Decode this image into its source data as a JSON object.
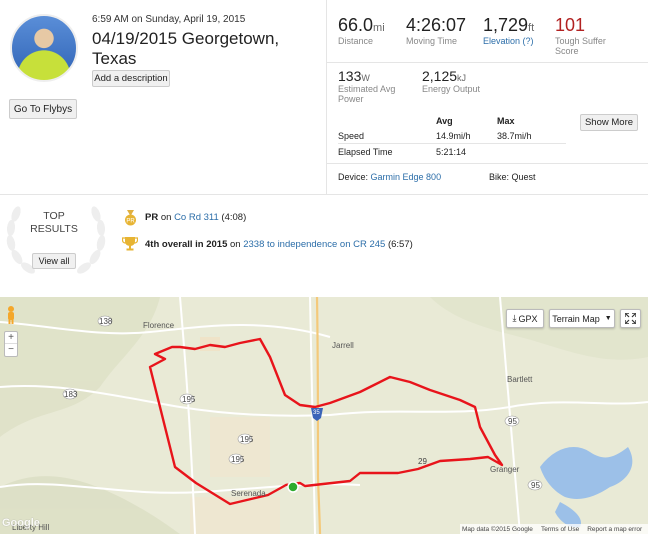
{
  "header": {
    "datetime": "6:59 AM on Sunday, April 19, 2015",
    "title": "04/19/2015 Georgetown, Texas",
    "add_description": "Add a description",
    "go_to_flybys": "Go To Flybys"
  },
  "stats": {
    "distance": {
      "value": "66.0",
      "unit": "mi",
      "label": "Distance"
    },
    "moving_time": {
      "value": "4:26:07",
      "label": "Moving Time"
    },
    "elevation": {
      "value": "1,729",
      "unit": "ft",
      "label": "Elevation (?)"
    },
    "suffer": {
      "value": "101",
      "label": "Tough Suffer Score",
      "color": "#b22222"
    },
    "power": {
      "value": "133",
      "unit": "W",
      "label": "Estimated Avg Power"
    },
    "energy": {
      "value": "2,125",
      "unit": "kJ",
      "label": "Energy Output"
    },
    "table": {
      "avg_header": "Avg",
      "max_header": "Max",
      "speed_label": "Speed",
      "speed_avg": "14.9mi/h",
      "speed_max": "38.7mi/h",
      "elapsed_label": "Elapsed Time",
      "elapsed_avg": "5:21:14"
    },
    "show_more": "Show More",
    "device_label": "Device:",
    "device_value": "Garmin Edge 800",
    "bike_label": "Bike:",
    "bike_value": "Quest"
  },
  "top_results": {
    "title_line1": "TOP",
    "title_line2": "RESULTS",
    "view_all": "View all",
    "items": [
      {
        "bold": "PR",
        "mid": " on ",
        "link": "Co Rd 311",
        "tail": " (4:08)"
      },
      {
        "bold": "4th overall in 2015",
        "mid": " on ",
        "link": "2338 to independence on CR 245",
        "tail": " (6:57)"
      }
    ]
  },
  "map": {
    "gpx": "GPX",
    "map_type": "Terrain Map",
    "zoom_in": "+",
    "zoom_out": "−",
    "towns": {
      "florence": "Florence",
      "jarrell": "Jarrell",
      "bartlett": "Bartlett",
      "granger": "Granger",
      "serenada": "Serenada",
      "liberty_hill": "Liberty Hill"
    },
    "roads": {
      "r138": "138",
      "r183": "183",
      "r195a": "195",
      "r195b": "195",
      "r195c": "195",
      "r29": "29",
      "r95a": "95",
      "r95b": "95",
      "i35": "35"
    },
    "footer": {
      "google": "Google",
      "map_data": "Map data ©2015 Google",
      "terms": "Terms of Use",
      "report": "Report a map error"
    },
    "route_color": "#e8141b",
    "start_color": "#2eaa2e"
  }
}
